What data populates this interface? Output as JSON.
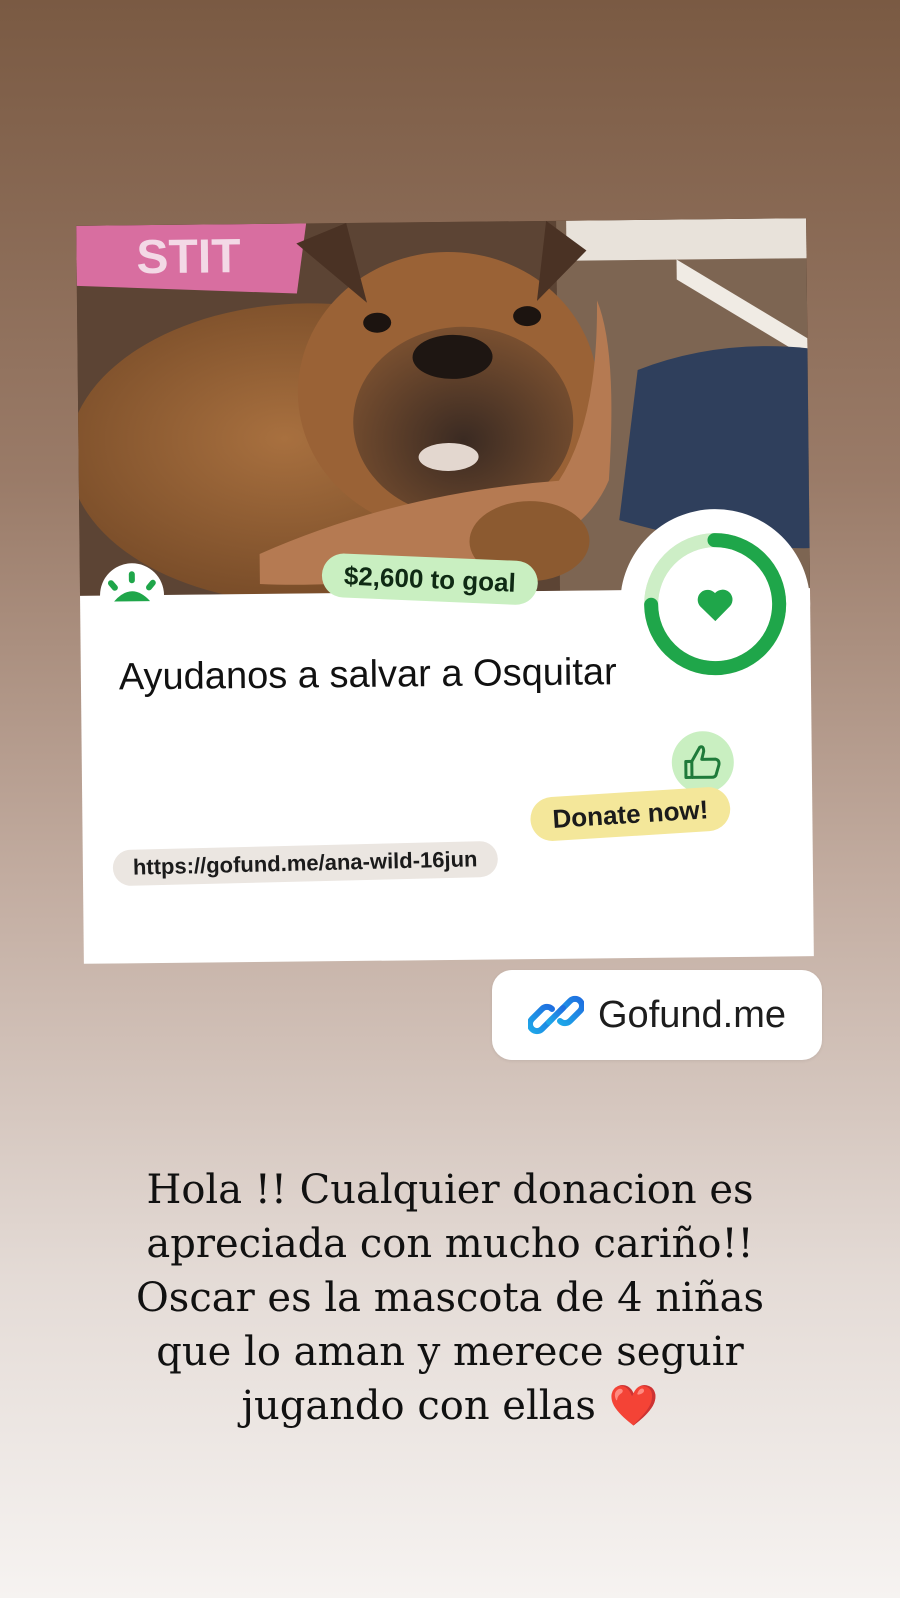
{
  "fundraiser": {
    "goal_text": "$2,600 to goal",
    "title": "Ayudanos a salvar a Osquitar",
    "donate_label": "Donate now!",
    "url": "https://gofund.me/ana-wild-16jun",
    "progress_fraction": 0.75,
    "colors": {
      "brand_green": "#1fa64a",
      "goal_pill": "#c9efc1",
      "donate_pill": "#f4e79a"
    }
  },
  "link_sticker": {
    "label": "Gofund.me",
    "icon": "link-icon"
  },
  "caption": {
    "text": "Hola !!  Cualquier donacion es\napreciada con mucho cariño!!\nOscar es la mascota de 4 niñas\nque lo aman y merece seguir\njugando con ellas",
    "emoji": "❤️"
  }
}
